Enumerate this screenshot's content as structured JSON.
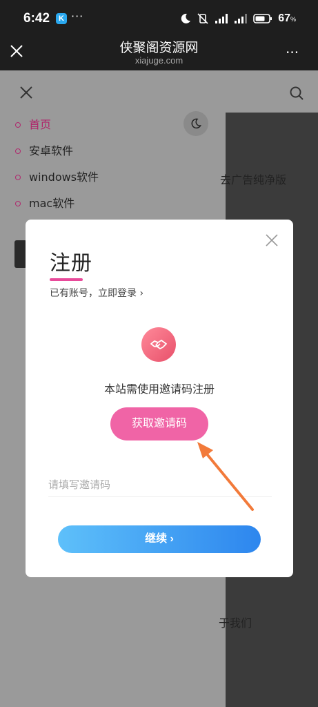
{
  "status_bar": {
    "time": "6:42",
    "app_badge": "K",
    "more": "···",
    "battery_percent": "67",
    "battery_unit": "%"
  },
  "browser": {
    "title": "侠聚阁资源网",
    "url": "xiajuge.com",
    "more": "···"
  },
  "side_menu": {
    "items": [
      {
        "label": "首页",
        "active": true
      },
      {
        "label": "安卓软件",
        "active": false
      },
      {
        "label": "windows软件",
        "active": false
      },
      {
        "label": "mac软件",
        "active": false
      }
    ]
  },
  "background_fragments": {
    "frag1": "去广告纯净版",
    "frag2": "于我们"
  },
  "modal": {
    "title": "注册",
    "login_link": "已有账号，立即登录 ›",
    "message": "本站需使用邀请码注册",
    "get_code_button": "获取邀请码",
    "code_placeholder": "请填写邀请码",
    "continue_button": "继续 ›"
  },
  "colors": {
    "accent_pink": "#f064a6",
    "accent_blue": "#2d86ee",
    "arrow_orange": "#f27a3a"
  }
}
